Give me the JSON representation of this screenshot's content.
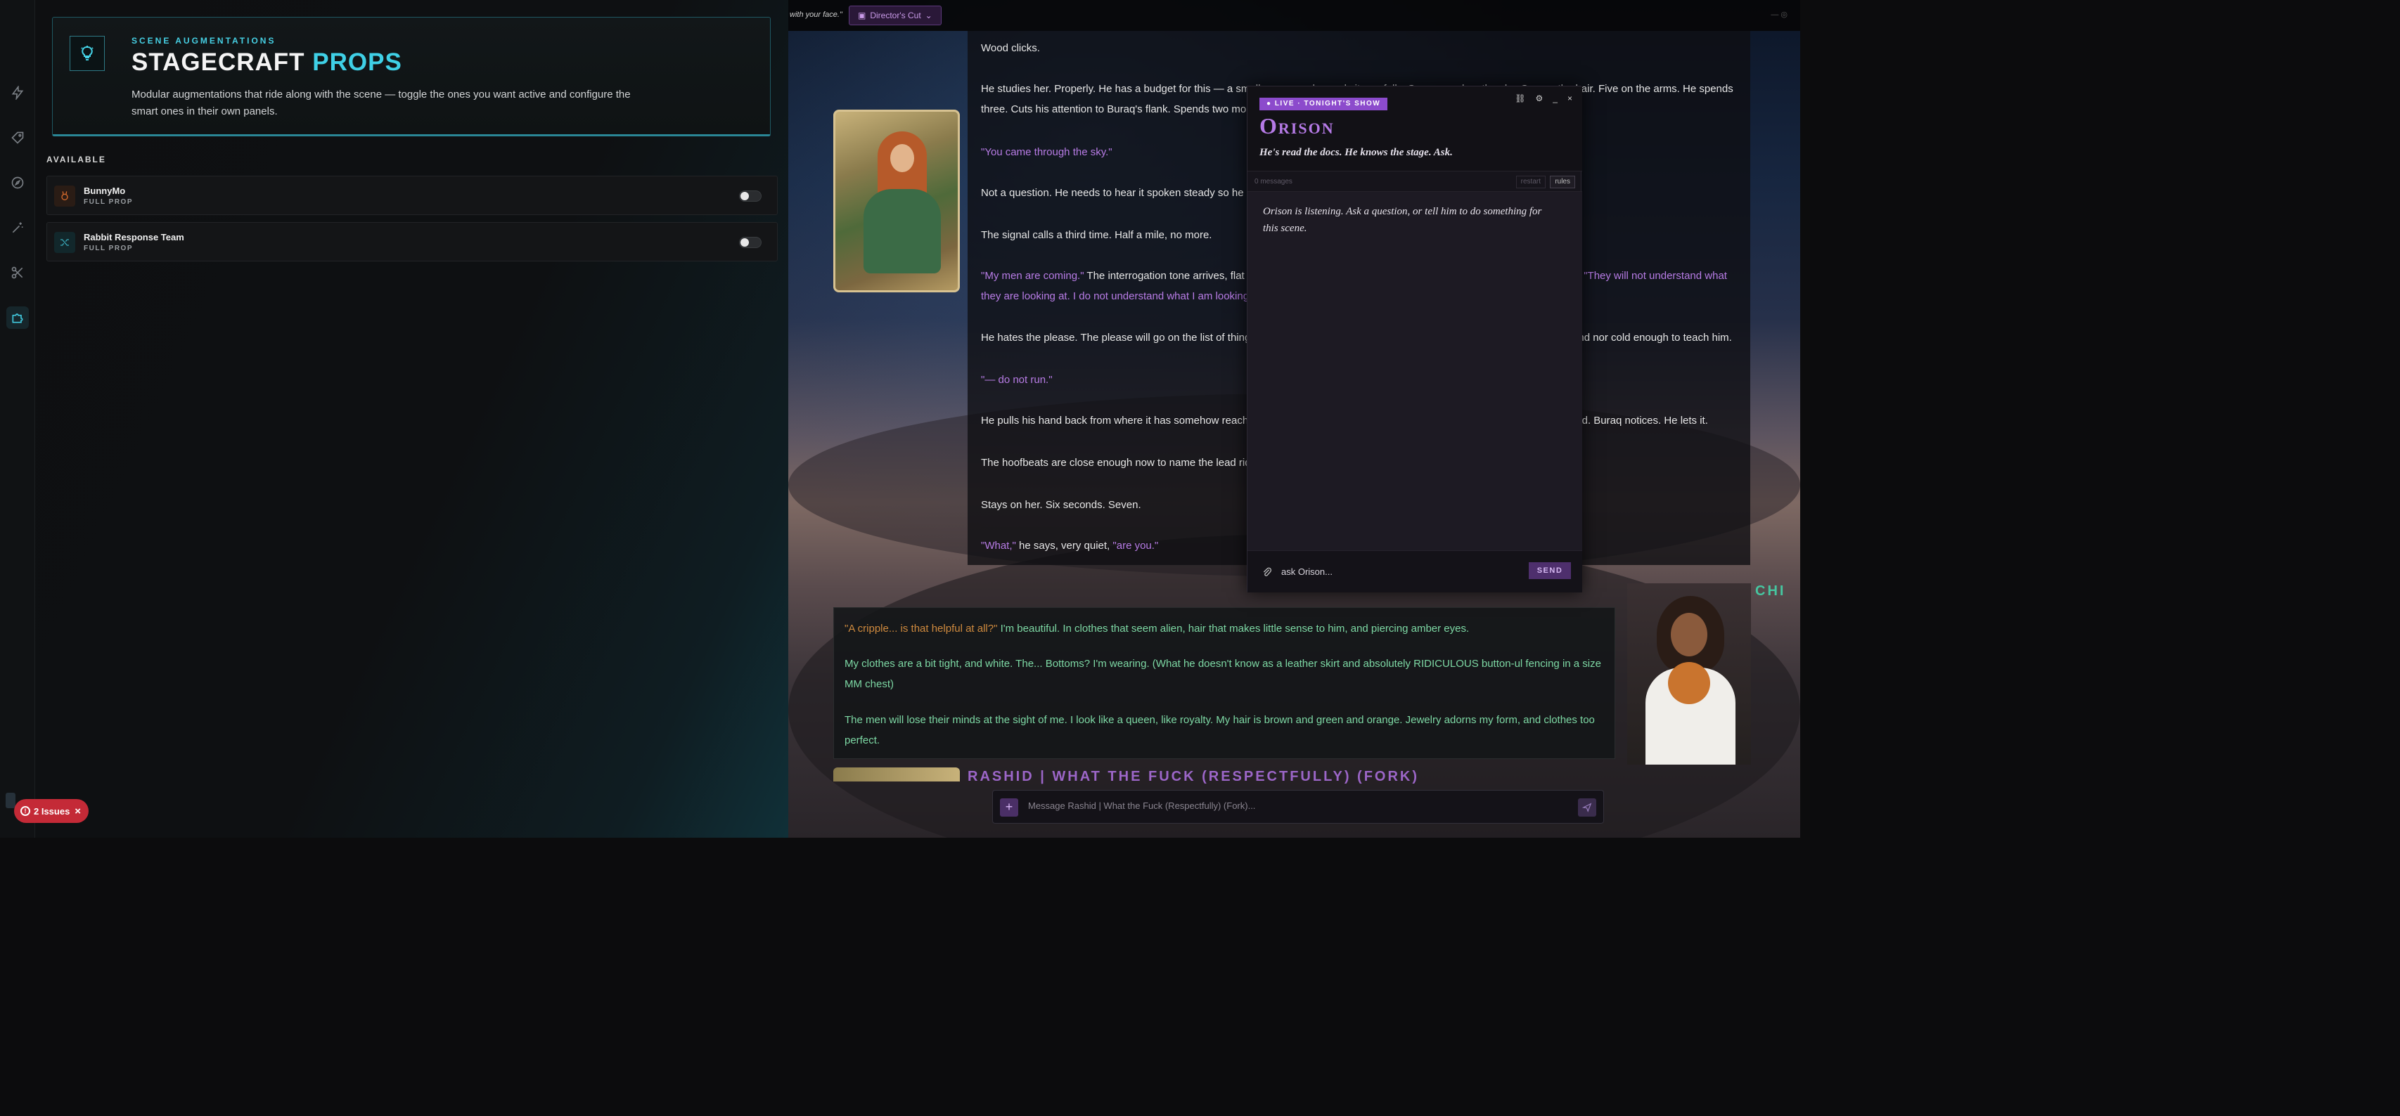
{
  "rail": {
    "icons": [
      "bolt-icon",
      "tag-icon",
      "compass-icon",
      "wand-icon",
      "scissors-icon",
      "puzzle-icon"
    ]
  },
  "hero": {
    "kicker": "SCENE AUGMENTATIONS",
    "title_main": "STAGECRAFT",
    "title_accent": "PROPS",
    "description": "Modular augmentations that ride along with the scene — toggle the ones you want active and configure the smart ones in their own panels."
  },
  "available_label": "AVAILABLE",
  "props": [
    {
      "name": "BunnyMo",
      "tag": "FULL PROP",
      "enabled": false,
      "icon": "bunny-icon",
      "color": "#d46a2c"
    },
    {
      "name": "Rabbit Response Team",
      "tag": "FULL PROP",
      "enabled": false,
      "icon": "shuffle-icon",
      "color": "#3aa8b8"
    }
  ],
  "issues": {
    "label": "2 Issues"
  },
  "topbar": {
    "snippet": "with your face.\"",
    "directors_cut": "Director's Cut"
  },
  "chat": {
    "messages": [
      {
        "text": "Wood clicks."
      },
      {
        "text": "He studies her. Properly. He has a budget for this — a small one — and spends it carefully. One second on the sky. One on the hair. Five on the arms. He spends three. Cuts his attention to Buraq's flank. Spends two more. Comes back."
      },
      {
        "quote": "\"You came through the sky.\""
      },
      {
        "text": "Not a question. He needs to hear it spoken steady so he can file it."
      },
      {
        "text": "The signal calls a third time. Half a mile, no more."
      },
      {
        "quote": "\"My men are coming.\"",
        "text": " The interrogation tone arrives, flat and practical. He lets it sit, then adds, almost gently, on the next breath. ",
        "quote2": "\"They will not understand what they are looking at. I do not understand what I am looking at.\""
      },
      {
        "text": "He hates the please. The please will go on the list of things he will be made to pay for later, by a god he is fairly sure is neither kind nor cold enough to teach him."
      },
      {
        "quote": "\"— do not run.\""
      },
      {
        "text": "He pulls his hand back from where it has somehow reached toward her without permission, and rests it on the saddle horn instead. Buraq notices. He lets it."
      },
      {
        "text": "The hoofbeats are close enough now to name the lead rider by gait. He does not turn his head."
      },
      {
        "text": "Stays on her. Six seconds. Seven."
      },
      {
        "quote": "\"What,\"",
        "text": " he says, very quiet, ",
        "quote2": "\"are you.\""
      }
    ],
    "char_name": "CHI",
    "user_messages": [
      {
        "orange": "\"A cripple... is that helpful at all?\"",
        "text": " I'm beautiful. In clothes that seem alien, hair that makes little sense to him, and piercing amber eyes."
      },
      {
        "text": "My clothes are a bit tight, and white. The... Bottoms? I'm wearing. (What he doesn't know as a leather skirt and absolutely RIDICULOUS button-ul fencing in a size MM chest)"
      },
      {
        "text": "The men will lose their minds at the sight of me. I look like a queen, like royalty. My hair is brown and green and orange. Jewelry adorns my form, and clothes too perfect."
      }
    ],
    "next_name": "RASHID | WHAT THE FUCK (RESPECTFULLY) (FORK)",
    "composer_placeholder": "Message Rashid | What the Fuck (Respectfully) (Fork)..."
  },
  "orison": {
    "badge": "● LIVE · TONIGHT'S SHOW",
    "title": "Orison",
    "subtitle": "He's read the docs. He knows the stage. Ask.",
    "controls": [
      "link-icon",
      "gear-icon",
      "minimize-icon",
      "close-icon"
    ],
    "message_count": "0 messages",
    "restart": "restart",
    "rules": "rules",
    "greeting": "Orison is listening. Ask a question, or tell him to do something for this scene.",
    "input_placeholder": "ask Orison...",
    "send": "SEND"
  },
  "colors": {
    "accent_cyan": "#3fd0e6",
    "accent_purple": "#b57ae6",
    "issue_red": "#c42a37"
  }
}
